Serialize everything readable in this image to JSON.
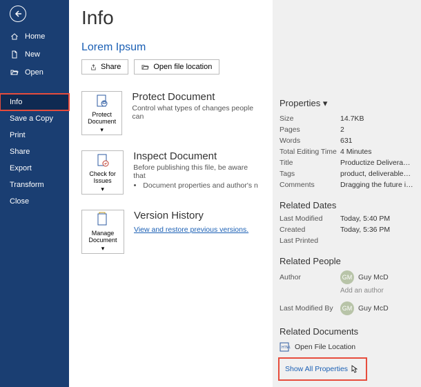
{
  "sidebar": {
    "items": [
      {
        "label": "Home",
        "icon": "home"
      },
      {
        "label": "New",
        "icon": "new"
      },
      {
        "label": "Open",
        "icon": "open"
      },
      {
        "label": "Info",
        "icon": ""
      },
      {
        "label": "Save a Copy",
        "icon": ""
      },
      {
        "label": "Print",
        "icon": ""
      },
      {
        "label": "Share",
        "icon": ""
      },
      {
        "label": "Export",
        "icon": ""
      },
      {
        "label": "Transform",
        "icon": ""
      },
      {
        "label": "Close",
        "icon": ""
      }
    ]
  },
  "main": {
    "pageTitle": "Info",
    "docTitle": "Lorem Ipsum",
    "shareBtn": "Share",
    "openLocBtn": "Open file location",
    "protect": {
      "tile": "Protect Document",
      "title": "Protect Document",
      "desc": "Control what types of changes people can"
    },
    "inspect": {
      "tile": "Check for Issues",
      "title": "Inspect Document",
      "desc": "Before publishing this file, be aware that",
      "bullet": "Document properties and author's n"
    },
    "version": {
      "tile": "Manage Document",
      "title": "Version History",
      "link": "View and restore previous versions."
    }
  },
  "props": {
    "header": "Properties",
    "rows": {
      "size": {
        "k": "Size",
        "v": "14.7KB"
      },
      "pages": {
        "k": "Pages",
        "v": "2"
      },
      "words": {
        "k": "Words",
        "v": "631"
      },
      "editTime": {
        "k": "Total Editing Time",
        "v": "4 Minutes"
      },
      "title": {
        "k": "Title",
        "v": "Productize Deliverables"
      },
      "tags": {
        "k": "Tags",
        "v": "product, deliverables, opti…"
      },
      "comments": {
        "k": "Comments",
        "v": "Dragging the future into n…"
      }
    },
    "dates": {
      "header": "Related Dates",
      "modified": {
        "k": "Last Modified",
        "v": "Today, 5:40 PM"
      },
      "created": {
        "k": "Created",
        "v": "Today, 5:36 PM"
      },
      "printed": {
        "k": "Last Printed",
        "v": ""
      }
    },
    "people": {
      "header": "Related People",
      "author": {
        "k": "Author",
        "initials": "GM",
        "name": "Guy McD"
      },
      "addAuthor": "Add an author",
      "lastMod": {
        "k": "Last Modified By",
        "initials": "GM",
        "name": "Guy McD"
      }
    },
    "docs": {
      "header": "Related Documents",
      "openLoc": "Open File Location",
      "showAll": "Show All Properties"
    }
  }
}
